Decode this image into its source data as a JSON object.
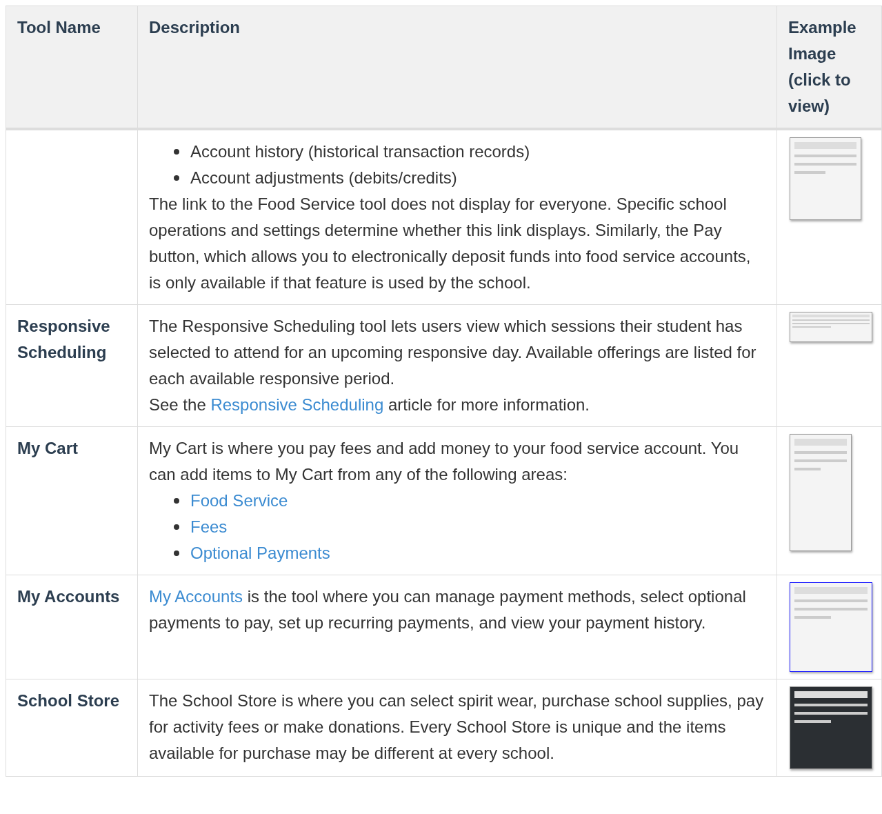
{
  "table": {
    "columns": [
      "Tool Name",
      "Description",
      "Example Image (click to view)"
    ],
    "rows": [
      {
        "description": [
          {
            "kind": "bullets",
            "items": [
              {
                "text": "Account history (historical transaction records)",
                "link": false
              },
              {
                "text": "Account adjustments (debits/credits)",
                "link": false
              }
            ]
          },
          {
            "kind": "paragraph",
            "parts": [
              {
                "text": "The link to the Food Service tool does not display for everyone. Specific school operations and settings determine whether this link displays. Similarly, the Pay button, which allows you to electronically deposit funds into food service accounts, is only available if that feature is used by the school.",
                "link": false
              }
            ]
          }
        ]
      },
      {
        "tool_name": "Responsive Scheduling",
        "description": [
          {
            "kind": "paragraph",
            "parts": [
              {
                "text": "The Responsive Scheduling tool lets users view which sessions their student has selected to attend for an upcoming responsive day. Available offerings are listed for each available responsive period.",
                "link": false
              }
            ]
          },
          {
            "kind": "paragraph",
            "parts": [
              {
                "text": "See the ",
                "link": false
              },
              {
                "text": "Responsive Scheduling",
                "link": true
              },
              {
                "text": " article for more information.",
                "link": false
              }
            ]
          }
        ]
      },
      {
        "tool_name": "My Cart",
        "description": [
          {
            "kind": "paragraph",
            "parts": [
              {
                "text": "My Cart is where you pay fees and add money to your food service account. You can add items to My Cart from any of the following areas:",
                "link": false
              }
            ]
          },
          {
            "kind": "bullets",
            "items": [
              {
                "text": "Food Service",
                "link": true
              },
              {
                "text": "Fees",
                "link": true
              },
              {
                "text": "Optional Payments",
                "link": true
              }
            ]
          }
        ]
      },
      {
        "tool_name": "My Accounts",
        "description": [
          {
            "kind": "paragraph",
            "parts": [
              {
                "text": "My Accounts",
                "link": true
              },
              {
                "text": " is the tool where you can manage payment methods, select optional payments to pay, set up recurring payments, and view your payment history.",
                "link": false
              }
            ]
          }
        ]
      },
      {
        "tool_name": "School Store",
        "description": [
          {
            "kind": "paragraph",
            "parts": [
              {
                "text": "The School Store is where you can select spirit wear, purchase school supplies, pay for activity fees or make donations. Every School Store is unique and the items available for purchase may be different at every school.",
                "link": false
              }
            ]
          }
        ]
      }
    ]
  }
}
